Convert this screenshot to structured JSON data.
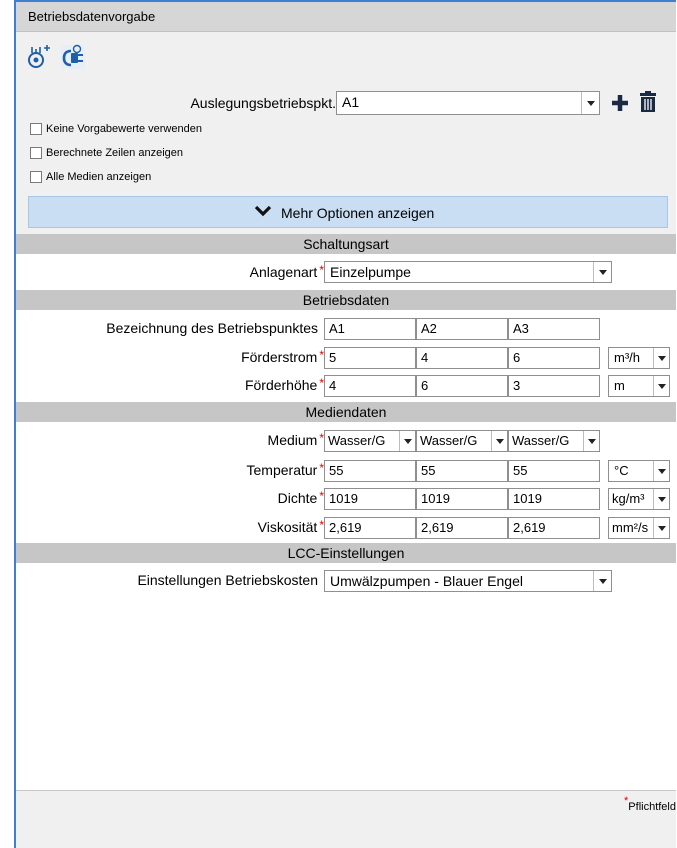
{
  "window": {
    "title": "Betriebsdatenvorgabe"
  },
  "toolbar": {
    "icons": [
      "pump-settings-icon",
      "energy-plug-icon"
    ]
  },
  "auslegung": {
    "label": "Auslegungsbetriebspkt.",
    "value": "A1",
    "add_icon": "plus-icon",
    "delete_icon": "trash-icon"
  },
  "checkboxes": [
    {
      "label": "Keine Vorgabewerte verwenden",
      "checked": false
    },
    {
      "label": "Berechnete Zeilen anzeigen",
      "checked": false
    },
    {
      "label": "Alle Medien anzeigen",
      "checked": false
    }
  ],
  "more_options": {
    "label": "Mehr Optionen anzeigen",
    "icon": "chevron-down-icon"
  },
  "sections": {
    "schaltungsart": "Schaltungsart",
    "betriebsdaten": "Betriebsdaten",
    "mediendaten": "Mediendaten",
    "lcc": "LCC-Einstellungen"
  },
  "anlagenart": {
    "label": "Anlagenart",
    "value": "Einzelpumpe"
  },
  "betriebsdaten": {
    "bezeichnung": {
      "label": "Bezeichnung des Betriebspunktes",
      "values": [
        "A1",
        "A2",
        "A3"
      ]
    },
    "foerderstrom": {
      "label": "Förderstrom",
      "values": [
        "5",
        "4",
        "6"
      ],
      "unit": "m³/h"
    },
    "foerderhoehe": {
      "label": "Förderhöhe",
      "values": [
        "4",
        "6",
        "3"
      ],
      "unit": "m"
    }
  },
  "mediendaten": {
    "medium": {
      "label": "Medium",
      "values": [
        "Wasser/G",
        "Wasser/G",
        "Wasser/G"
      ]
    },
    "temperatur": {
      "label": "Temperatur",
      "values": [
        "55",
        "55",
        "55"
      ],
      "unit": "°C"
    },
    "dichte": {
      "label": "Dichte",
      "values": [
        "1019",
        "1019",
        "1019"
      ],
      "unit": "kg/m³"
    },
    "viskositaet": {
      "label": "Viskosität",
      "values": [
        "2,619",
        "2,619",
        "2,619"
      ],
      "unit": "mm²/s"
    }
  },
  "lcc": {
    "label": "Einstellungen Betriebskosten",
    "value": "Umwälzpumpen - Blauer Engel"
  },
  "footer": {
    "required_asterisk": "*",
    "required_label": "Pflichtfeld"
  },
  "colors": {
    "accent": "#3f7fd1",
    "required": "#e00000",
    "section": "#c6c6c6",
    "more_bg": "#c9def3"
  }
}
